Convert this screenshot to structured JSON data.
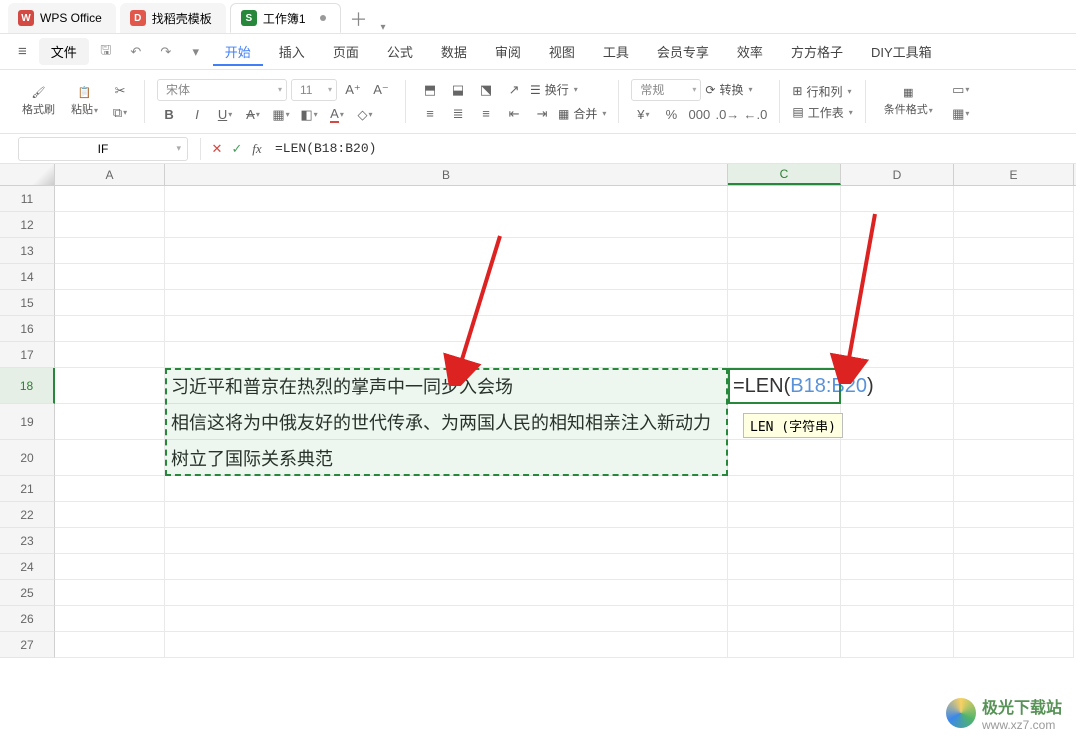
{
  "tabs": {
    "t0": {
      "label": "WPS Office"
    },
    "t1": {
      "label": "找稻壳模板"
    },
    "t2": {
      "label": "工作簿1"
    }
  },
  "menu": {
    "file": "文件",
    "items": [
      "开始",
      "插入",
      "页面",
      "公式",
      "数据",
      "审阅",
      "视图",
      "工具",
      "会员专享",
      "效率",
      "方方格子",
      "DIY工具箱"
    ]
  },
  "ribbon": {
    "brush": "格式刷",
    "paste": "粘贴",
    "font_name": "宋体",
    "font_size": "11",
    "wrap": "换行",
    "merge": "合并",
    "numfmt": "常规",
    "convert": "转换",
    "rowcol": "行和列",
    "worksheet": "工作表",
    "condfmt": "条件格式"
  },
  "namebox": "IF",
  "formula": "=LEN(B18:B20)",
  "overlay": {
    "pre": "=LEN(",
    "range": "B18:B20",
    "post": ")"
  },
  "hint": "LEN (字符串)",
  "cols": [
    "A",
    "B",
    "C",
    "D",
    "E"
  ],
  "rows": [
    "11",
    "12",
    "13",
    "14",
    "15",
    "16",
    "17",
    "18",
    "19",
    "20",
    "21",
    "22",
    "23",
    "24",
    "25",
    "26",
    "27"
  ],
  "cells": {
    "B18": "习近平和普京在热烈的掌声中一同步入会场",
    "B19": "相信这将为中俄友好的世代传承、为两国人民的相知相亲注入新动力",
    "B20": "树立了国际关系典范"
  },
  "watermark": {
    "title": "极光下载站",
    "url": "www.xz7.com"
  }
}
